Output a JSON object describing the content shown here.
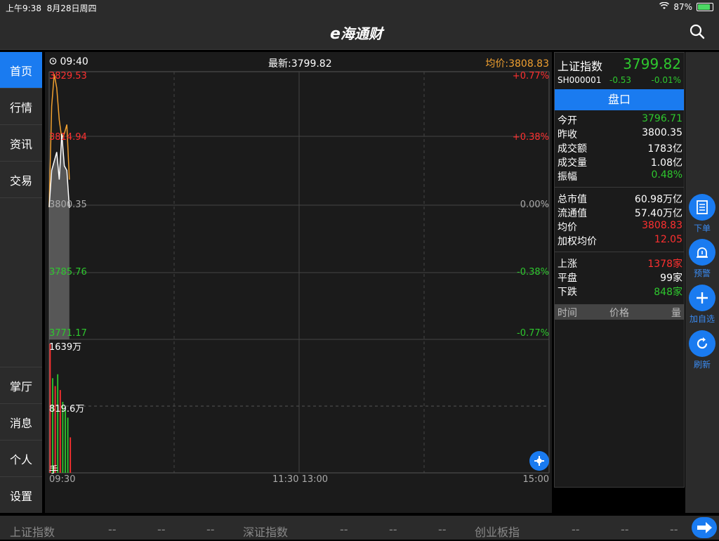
{
  "status": {
    "time": "上午9:38",
    "date": "8月28日周四",
    "battery": "87%",
    "battery_fraction": 0.87
  },
  "header": {
    "logo": "海通财",
    "logo_e": "e"
  },
  "sidebar": {
    "top": [
      {
        "label": "首页"
      },
      {
        "label": "行情"
      },
      {
        "label": "资讯"
      },
      {
        "label": "交易"
      }
    ],
    "bottom": [
      {
        "label": "掌厅"
      },
      {
        "label": "消息"
      },
      {
        "label": "个人"
      },
      {
        "label": "设置"
      }
    ]
  },
  "chart_header": {
    "time": "09:40",
    "latest": "最新:3799.82",
    "avg": "均价:3808.83"
  },
  "price_axis": {
    "left": [
      "3829.53",
      "3814.94",
      "3800.35",
      "3785.76",
      "3771.17"
    ],
    "right": [
      "+0.77%",
      "+0.38%",
      "0.00%",
      "-0.38%",
      "-0.77%"
    ]
  },
  "volume_axis": {
    "max": "1639万",
    "mid": "819.6万",
    "unit": "手"
  },
  "time_axis": {
    "start": "09:30",
    "mid": "11:30 13:00",
    "end": "15:00"
  },
  "chart_data": {
    "type": "line",
    "x": [
      "09:30",
      "09:31",
      "09:32",
      "09:33",
      "09:34",
      "09:35",
      "09:36",
      "09:37",
      "09:38"
    ],
    "ylim": [
      3771.17,
      3829.53
    ],
    "series": [
      {
        "values": [
          3800.0,
          3822.0,
          3829.0,
          3826.0,
          3819.0,
          3815.0,
          3816.0,
          3818.0,
          3806.0
        ],
        "color": "#f0a030"
      },
      {
        "values": [
          3800.0,
          3808.0,
          3810.0,
          3812.0,
          3806.0,
          3816.0,
          3809.0,
          3808.0,
          3799.82
        ],
        "color": "#ffffff"
      }
    ],
    "volume": {
      "ylim": [
        0,
        1639
      ],
      "values": [
        1639,
        1200,
        1100,
        1250,
        1050,
        900,
        800,
        700,
        450
      ],
      "colors": [
        "red",
        "green",
        "red",
        "green",
        "red",
        "green",
        "green",
        "green",
        "red"
      ]
    }
  },
  "quote": {
    "name": "上证指数",
    "price": "3799.82",
    "code": "SH000001",
    "change": "-0.53",
    "pct": "-0.01%",
    "pankou": "盘口",
    "group1": [
      {
        "label": "今开",
        "value": "3796.71",
        "color": "green"
      },
      {
        "label": "昨收",
        "value": "3800.35",
        "color": "white"
      },
      {
        "label": "成交额",
        "value": "1783亿",
        "color": "white"
      },
      {
        "label": "成交量",
        "value": "1.08亿",
        "color": "white"
      },
      {
        "label": "振幅",
        "value": "0.48%",
        "color": "green"
      }
    ],
    "group2": [
      {
        "label": "总市值",
        "value": "60.98万亿",
        "color": "white"
      },
      {
        "label": "流通值",
        "value": "57.40万亿",
        "color": "white"
      },
      {
        "label": "均价",
        "value": "3808.83",
        "color": "red"
      },
      {
        "label": "加权均价",
        "value": "12.05",
        "color": "red"
      }
    ],
    "group3": [
      {
        "label": "上涨",
        "value": "1378家",
        "color": "red"
      },
      {
        "label": "平盘",
        "value": "99家",
        "color": "white"
      },
      {
        "label": "下跌",
        "value": "848家",
        "color": "green"
      }
    ],
    "table_headers": {
      "time": "时间",
      "price": "价格",
      "volume": "量"
    }
  },
  "tools": [
    {
      "label": "下单",
      "icon": "order-icon"
    },
    {
      "label": "预警",
      "icon": "alarm-icon"
    },
    {
      "label": "加自选",
      "icon": "plus-icon"
    },
    {
      "label": "刷新",
      "icon": "refresh-icon"
    }
  ],
  "ticker": [
    {
      "name": "上证指数",
      "v1": "--",
      "v2": "--",
      "v3": "--"
    },
    {
      "name": "深证指数",
      "v1": "--",
      "v2": "--",
      "v3": "--"
    },
    {
      "name": "创业板指",
      "v1": "--",
      "v2": "--",
      "v3": "--"
    }
  ]
}
